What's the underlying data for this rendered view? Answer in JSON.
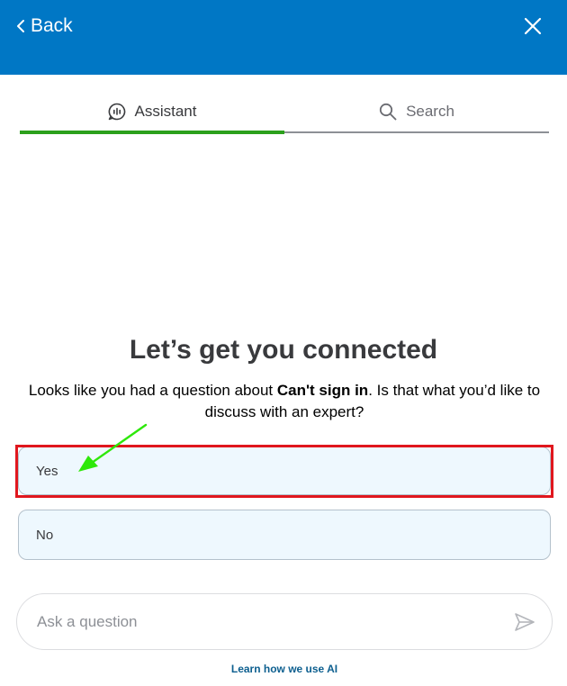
{
  "header": {
    "back_label": "Back",
    "background_color": "#0077c5",
    "icons": {
      "back": "chevron-left-icon",
      "close": "close-icon"
    }
  },
  "tabs": [
    {
      "label": "Assistant",
      "icon": "assistant-chat-icon",
      "active": true
    },
    {
      "label": "Search",
      "icon": "search-icon",
      "active": false
    }
  ],
  "tab_active_color": "#2ca01c",
  "content": {
    "title": "Let’s get you connected",
    "message_prefix": "Looks like you had a question about ",
    "message_topic": "Can't sign in",
    "message_suffix": ". Is that what you’d like to discuss with an expert?"
  },
  "options": [
    {
      "label": "Yes",
      "highlighted": true
    },
    {
      "label": "No",
      "highlighted": false
    }
  ],
  "annotation": {
    "highlight_color": "#e0171e",
    "arrow_color": "#2ee80a"
  },
  "ask_bar": {
    "placeholder": "Ask a question",
    "value": "",
    "send_icon": "send-icon"
  },
  "footer": {
    "learn_link": "Learn how we use AI"
  }
}
